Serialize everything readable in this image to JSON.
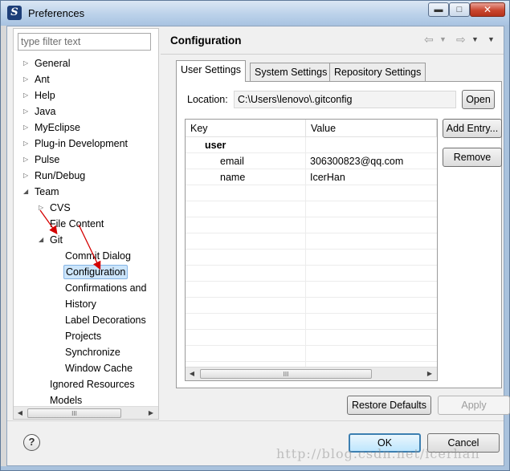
{
  "window": {
    "title": "Preferences",
    "app_icon_glyph": "S",
    "buttons": {
      "minimize": "▬",
      "maximize": "□",
      "close": "✕"
    }
  },
  "filter": {
    "placeholder": "type filter text",
    "value": ""
  },
  "tree": [
    {
      "label": "General",
      "depth": 0,
      "toggle": "collapsed"
    },
    {
      "label": "Ant",
      "depth": 0,
      "toggle": "collapsed"
    },
    {
      "label": "Help",
      "depth": 0,
      "toggle": "collapsed"
    },
    {
      "label": "Java",
      "depth": 0,
      "toggle": "collapsed"
    },
    {
      "label": "MyEclipse",
      "depth": 0,
      "toggle": "collapsed"
    },
    {
      "label": "Plug-in Development",
      "depth": 0,
      "toggle": "collapsed"
    },
    {
      "label": "Pulse",
      "depth": 0,
      "toggle": "collapsed"
    },
    {
      "label": "Run/Debug",
      "depth": 0,
      "toggle": "collapsed"
    },
    {
      "label": "Team",
      "depth": 0,
      "toggle": "expanded"
    },
    {
      "label": "CVS",
      "depth": 1,
      "toggle": "collapsed"
    },
    {
      "label": "File Content",
      "depth": 1,
      "toggle": "none"
    },
    {
      "label": "Git",
      "depth": 1,
      "toggle": "expanded"
    },
    {
      "label": "Commit Dialog",
      "depth": 2,
      "toggle": "none"
    },
    {
      "label": "Configuration",
      "depth": 2,
      "toggle": "none",
      "selected": true
    },
    {
      "label": "Confirmations and",
      "depth": 2,
      "toggle": "none"
    },
    {
      "label": "History",
      "depth": 2,
      "toggle": "none"
    },
    {
      "label": "Label Decorations",
      "depth": 2,
      "toggle": "none"
    },
    {
      "label": "Projects",
      "depth": 2,
      "toggle": "none"
    },
    {
      "label": "Synchronize",
      "depth": 2,
      "toggle": "none"
    },
    {
      "label": "Window Cache",
      "depth": 2,
      "toggle": "none"
    },
    {
      "label": "Ignored Resources",
      "depth": 1,
      "toggle": "none"
    },
    {
      "label": "Models",
      "depth": 1,
      "toggle": "none"
    }
  ],
  "page": {
    "title": "Configuration",
    "nav": {
      "back": "⇦",
      "forward": "⇨",
      "menu": "▼"
    }
  },
  "tabs": [
    {
      "label": "User Settings",
      "active": true
    },
    {
      "label": "System Settings",
      "active": false
    },
    {
      "label": "Repository Settings",
      "active": false
    }
  ],
  "location": {
    "label": "Location:",
    "value": "C:\\Users\\lenovo\\.gitconfig",
    "open_label": "Open"
  },
  "table": {
    "columns": [
      "Key",
      "Value"
    ],
    "rows": [
      {
        "key": "user",
        "value": "",
        "section": true
      },
      {
        "key": "email",
        "value": "306300823@qq.com",
        "section": false
      },
      {
        "key": "name",
        "value": "IcerHan",
        "section": false
      }
    ],
    "scroll_grip": "III"
  },
  "side_buttons": {
    "add_entry": "Add Entry...",
    "remove": "Remove"
  },
  "buttons": {
    "restore_defaults": "Restore Defaults",
    "apply": "Apply",
    "ok": "OK",
    "cancel": "Cancel",
    "help": "?"
  },
  "watermark": "http://blog.csdn.net/icerhan",
  "colors": {
    "selection": "#cce5fb",
    "annotation_arrow": "#d40000",
    "titlebar": "#bcd2ea"
  }
}
